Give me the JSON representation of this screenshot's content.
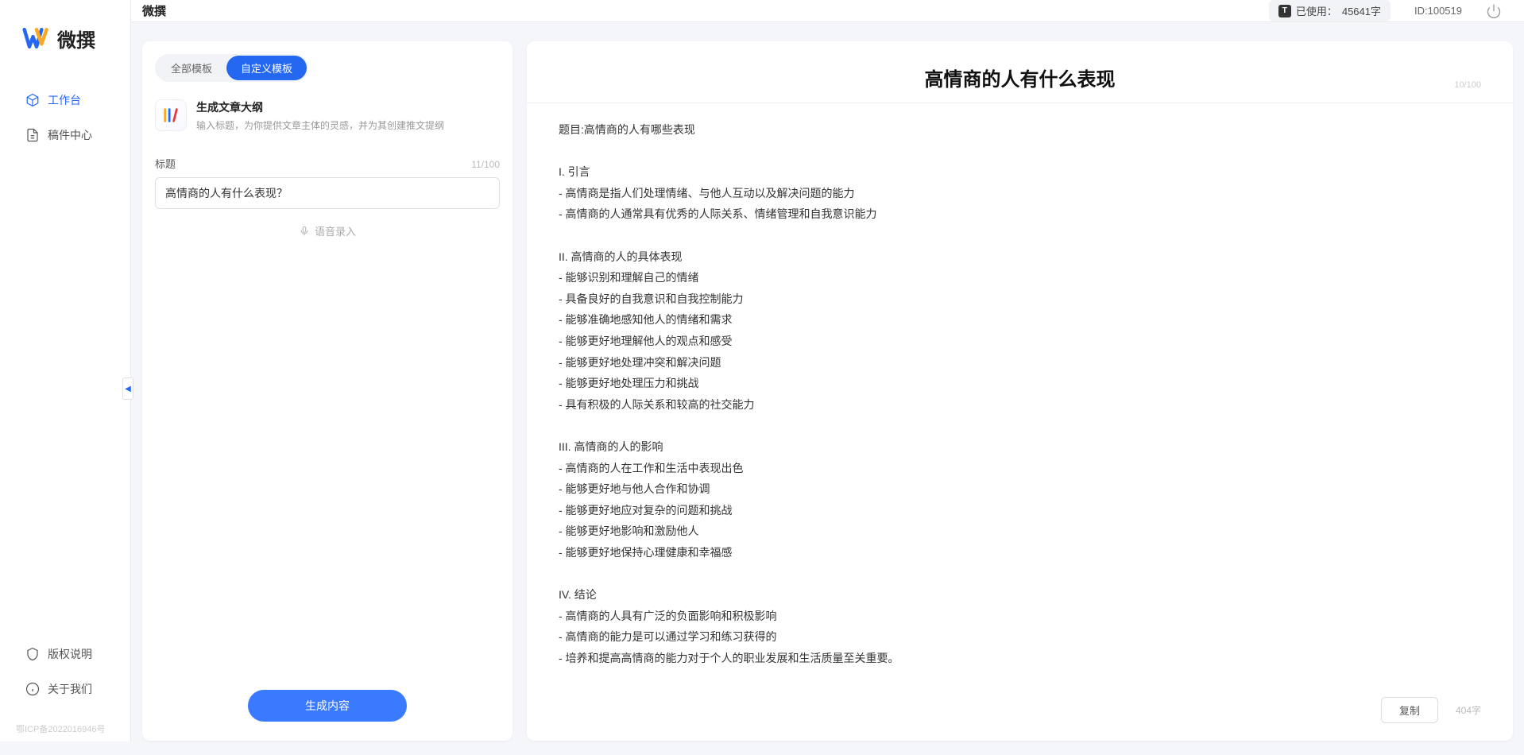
{
  "appName": "微撰",
  "topbar": {
    "pageTitle": "微撰",
    "usagePrefix": "已使用：",
    "usageValue": "45641字",
    "idLabel": "ID:100519"
  },
  "sidebar": {
    "nav": [
      {
        "icon": "cube",
        "label": "工作台",
        "active": true
      },
      {
        "icon": "doc",
        "label": "稿件中心",
        "active": false
      }
    ],
    "footer": [
      {
        "icon": "shield",
        "label": "版权说明"
      },
      {
        "icon": "info",
        "label": "关于我们"
      }
    ],
    "icp": "鄂ICP备2022016946号"
  },
  "leftPanel": {
    "tabs": [
      {
        "label": "全部模板",
        "active": false
      },
      {
        "label": "自定义模板",
        "active": true
      }
    ],
    "template": {
      "title": "生成文章大纲",
      "desc": "输入标题，为你提供文章主体的灵感，并为其创建推文提纲"
    },
    "form": {
      "titleLabel": "标题",
      "titleValue": "高情商的人有什么表现？",
      "titleCount": "11/100",
      "voiceLabel": "语音录入",
      "generateLabel": "生成内容"
    }
  },
  "output": {
    "title": "高情商的人有什么表现",
    "titleCharCount": "10/100",
    "body": "题目:高情商的人有哪些表现\n\nI. 引言\n- 高情商是指人们处理情绪、与他人互动以及解决问题的能力\n- 高情商的人通常具有优秀的人际关系、情绪管理和自我意识能力\n\nII. 高情商的人的具体表现\n- 能够识别和理解自己的情绪\n- 具备良好的自我意识和自我控制能力\n- 能够准确地感知他人的情绪和需求\n- 能够更好地理解他人的观点和感受\n- 能够更好地处理冲突和解决问题\n- 能够更好地处理压力和挑战\n- 具有积极的人际关系和较高的社交能力\n\nIII. 高情商的人的影响\n- 高情商的人在工作和生活中表现出色\n- 能够更好地与他人合作和协调\n- 能够更好地应对复杂的问题和挑战\n- 能够更好地影响和激励他人\n- 能够更好地保持心理健康和幸福感\n\nIV. 结论\n- 高情商的人具有广泛的负面影响和积极影响\n- 高情商的能力是可以通过学习和练习获得的\n- 培养和提高高情商的能力对于个人的职业发展和生活质量至关重要。",
    "copyLabel": "复制",
    "wordCount": "404字"
  }
}
